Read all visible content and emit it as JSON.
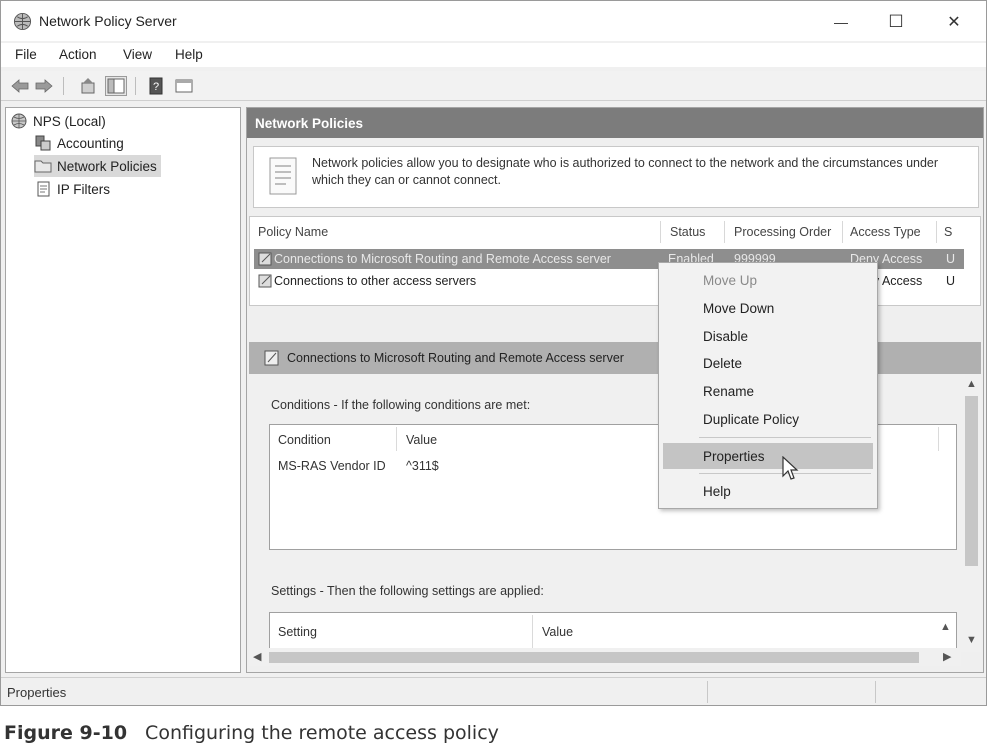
{
  "window": {
    "title": "Network Policy Server",
    "minimize_glyph": "—",
    "maximize_glyph": "☐",
    "close_glyph": "✕"
  },
  "menu": [
    "File",
    "Action",
    "View",
    "Help"
  ],
  "toolbar": {
    "icons": [
      "back-icon",
      "forward-icon",
      "up-icon",
      "show-hide-tree-icon",
      "help-icon",
      "console-icon"
    ]
  },
  "tree": {
    "root": "NPS (Local)",
    "items": [
      "Accounting",
      "Network Policies",
      "IP Filters"
    ],
    "selected": "Network Policies"
  },
  "right_pane": {
    "header": "Network Policies",
    "info_text": "Network policies allow you to designate who is authorized to connect to the network and the circumstances under which they can or cannot connect."
  },
  "policy_table": {
    "columns": [
      "Policy Name",
      "Status",
      "Processing Order",
      "Access Type",
      "S"
    ],
    "rows": [
      {
        "name": "Connections to Microsoft Routing and Remote Access server",
        "status": "Enabled",
        "order": "999999",
        "access": "Deny Access",
        "s": "U"
      },
      {
        "name": "Connections to other access servers",
        "status": "",
        "order": "",
        "access": "Deny Access",
        "s": "U"
      }
    ]
  },
  "details": {
    "header": "Connections to Microsoft Routing and Remote Access server",
    "conditions_label": "Conditions - If the following conditions are met:",
    "conditions_columns": [
      "Condition",
      "Value"
    ],
    "conditions_rows": [
      {
        "condition": "MS-RAS Vendor ID",
        "value": "^311$"
      }
    ],
    "settings_label": "Settings - Then the following settings are applied:",
    "settings_columns": [
      "Setting",
      "Value"
    ]
  },
  "context_menu": {
    "items": [
      {
        "label": "Move Up",
        "state": "disabled"
      },
      {
        "label": "Move Down",
        "state": "normal"
      },
      {
        "label": "Disable",
        "state": "normal"
      },
      {
        "label": "Delete",
        "state": "normal"
      },
      {
        "label": "Rename",
        "state": "normal"
      },
      {
        "label": "Duplicate Policy",
        "state": "normal"
      },
      {
        "label": "Properties",
        "state": "hover"
      },
      {
        "label": "Help",
        "state": "normal"
      }
    ]
  },
  "statusbar": {
    "text": "Properties"
  },
  "caption": {
    "number": "Figure 9-10",
    "text": "Configuring the remote access policy"
  },
  "colors": {
    "header_bg": "#7c7c7c",
    "selected_row": "#8e8e8e",
    "menu_hover": "#c4c4c4"
  }
}
